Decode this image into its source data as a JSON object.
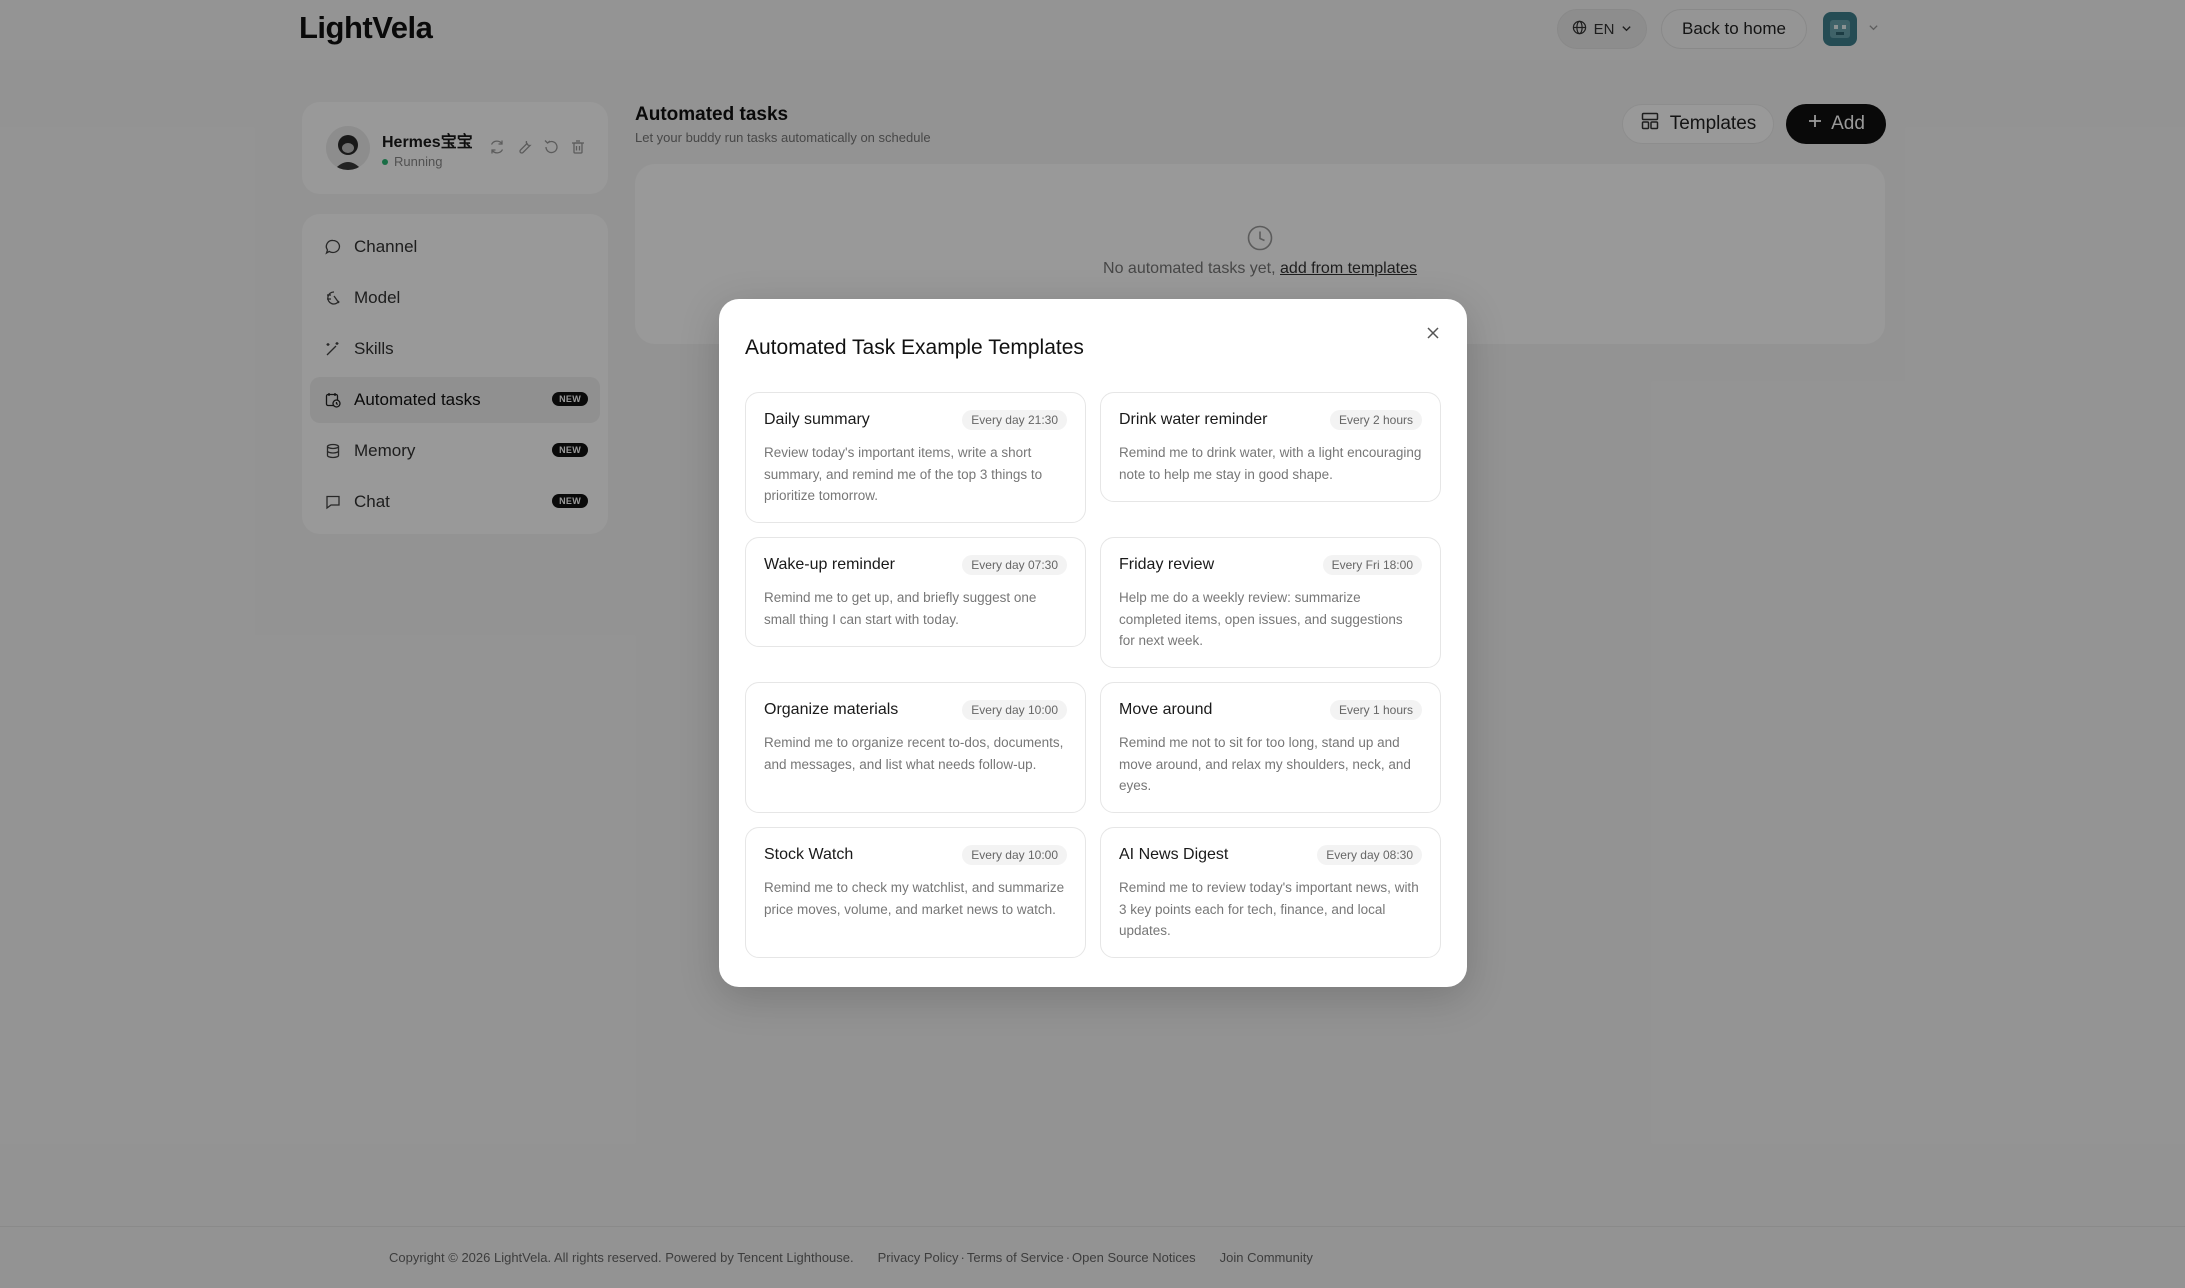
{
  "header": {
    "logo": "LightVela",
    "language": "EN",
    "back_home": "Back to home"
  },
  "profile": {
    "name": "Hermes宝宝",
    "status": "Running"
  },
  "sidebar": {
    "items": [
      {
        "label": "Channel",
        "icon": "chat-bubble-icon",
        "badge": ""
      },
      {
        "label": "Model",
        "icon": "model-icon",
        "badge": ""
      },
      {
        "label": "Skills",
        "icon": "magic-wand-icon",
        "badge": ""
      },
      {
        "label": "Automated tasks",
        "icon": "calendar-clock-icon",
        "badge": "NEW",
        "active": true
      },
      {
        "label": "Memory",
        "icon": "database-icon",
        "badge": "NEW"
      },
      {
        "label": "Chat",
        "icon": "message-square-icon",
        "badge": "NEW"
      }
    ]
  },
  "main": {
    "title": "Automated tasks",
    "subtitle": "Let your buddy run tasks automatically on schedule",
    "templates_label": "Templates",
    "add_label": "Add",
    "empty_text": "No automated tasks yet,",
    "empty_link": "add from templates"
  },
  "modal": {
    "title": "Automated Task Example Templates",
    "templates": [
      {
        "name": "Daily summary",
        "schedule": "Every day 21:30",
        "desc": "Review today's important items, write a short summary, and remind me of the top 3 things to prioritize tomorrow."
      },
      {
        "name": "Drink water reminder",
        "schedule": "Every 2 hours",
        "desc": "Remind me to drink water, with a light encouraging note to help me stay in good shape."
      },
      {
        "name": "Wake-up reminder",
        "schedule": "Every day 07:30",
        "desc": "Remind me to get up, and briefly suggest one small thing I can start with today."
      },
      {
        "name": "Friday review",
        "schedule": "Every Fri 18:00",
        "desc": "Help me do a weekly review: summarize completed items, open issues, and suggestions for next week."
      },
      {
        "name": "Organize materials",
        "schedule": "Every day 10:00",
        "desc": "Remind me to organize recent to-dos, documents, and messages, and list what needs follow-up."
      },
      {
        "name": "Move around",
        "schedule": "Every 1 hours",
        "desc": "Remind me not to sit for too long, stand up and move around, and relax my shoulders, neck, and eyes."
      },
      {
        "name": "Stock Watch",
        "schedule": "Every day 10:00",
        "desc": "Remind me to check my watchlist, and summarize price moves, volume, and market news to watch."
      },
      {
        "name": "AI News Digest",
        "schedule": "Every day 08:30",
        "desc": "Remind me to review today's important news, with 3 key points each for tech, finance, and local updates."
      }
    ]
  },
  "footer": {
    "copyright": "Copyright © 2026 LightVela. All rights reserved. Powered by Tencent Lighthouse.",
    "privacy": "Privacy Policy",
    "terms": "Terms of Service",
    "oss": "Open Source Notices",
    "community": "Join Community"
  }
}
